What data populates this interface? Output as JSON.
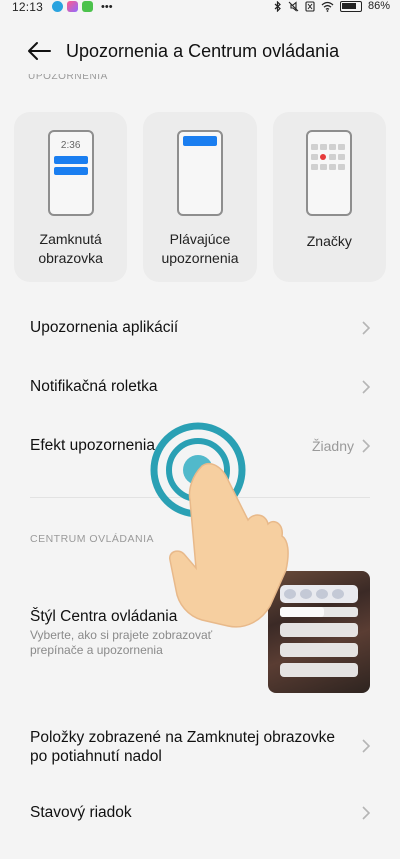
{
  "status_bar": {
    "time": "12:13",
    "battery": "86%",
    "more_glyph": "•••"
  },
  "header": {
    "title": "Upozornenia a Centrum ovládania"
  },
  "sections": {
    "notifications_label": "UPOZORNENIA",
    "control_center_label": "CENTRUM OVLÁDANIA"
  },
  "cards": [
    {
      "label": "Zamknutá obrazovka",
      "icon": "lock-screen-icon",
      "preview_time": "2:36"
    },
    {
      "label": "Plávajúce upozornenia",
      "icon": "floating-notification-icon"
    },
    {
      "label": "Značky",
      "icon": "badges-icon"
    }
  ],
  "menu": {
    "app_notifications": "Upozornenia aplikácií",
    "notification_shade": "Notifikačná roletka",
    "notification_effect": "Efekt upozornenia",
    "notification_effect_value": "Žiadny",
    "control_center_style_title": "Štýl Centra ovládania",
    "control_center_style_desc": "Vyberte, ako si prajete zobrazovať prepínače a upozornenia",
    "lock_screen_items": "Položky zobrazené na Zamknutej obrazovke po potiahnutí nadol",
    "status_bar": "Stavový riadok"
  },
  "colors": {
    "accent": "#1a7ef0",
    "tap_ring": "#2aa0b4",
    "hand": "#f6cfa0",
    "background": "#f4f4f4"
  }
}
